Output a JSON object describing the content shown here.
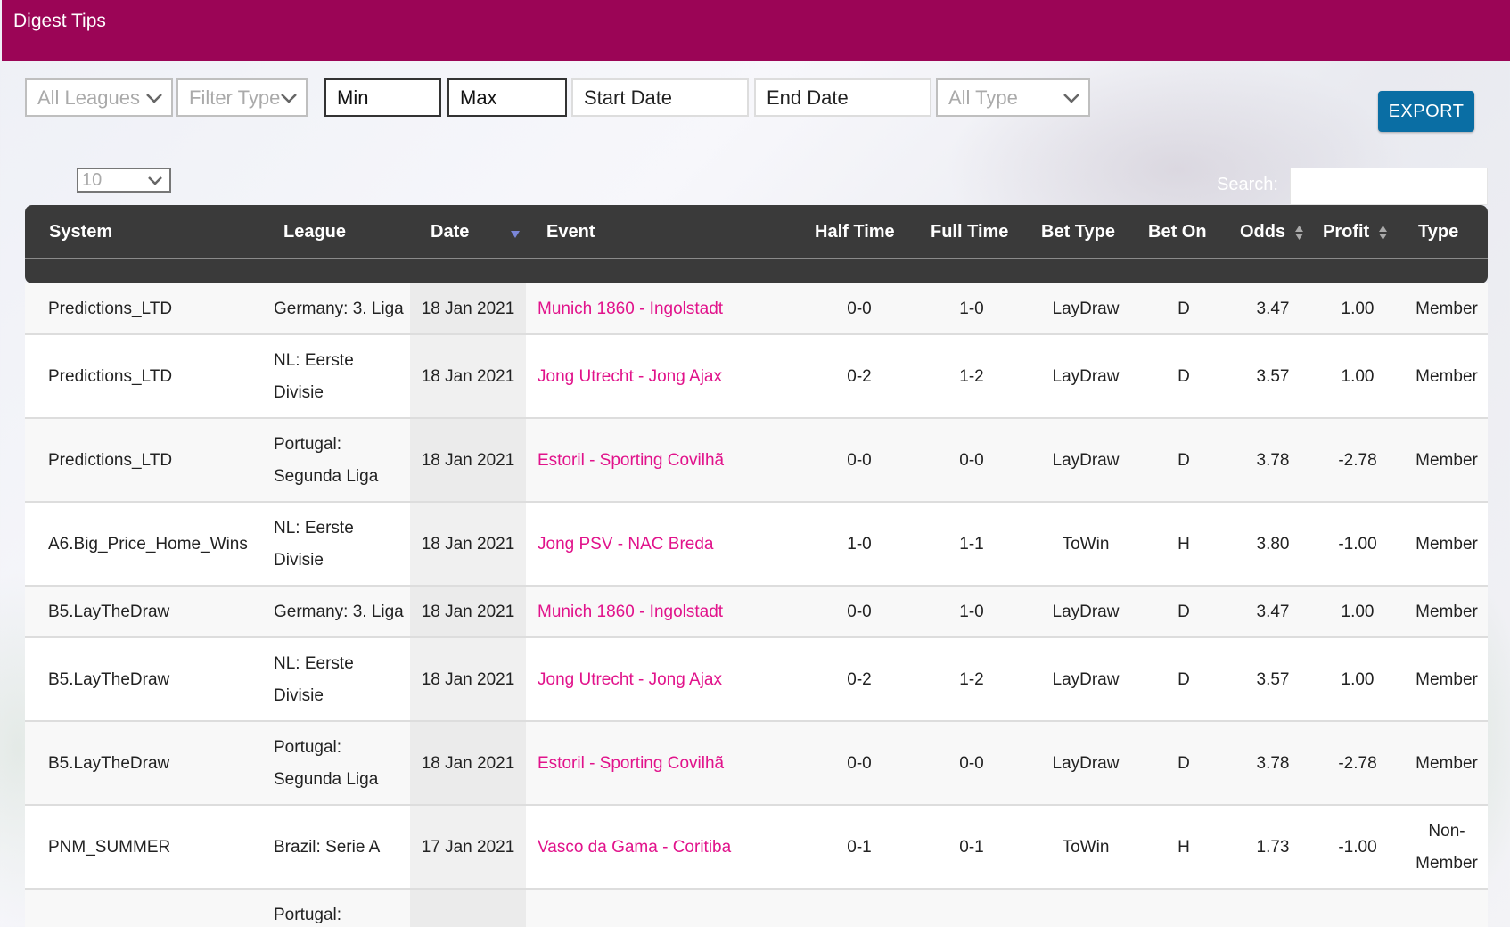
{
  "header": {
    "title": "Digest Tips"
  },
  "filters": {
    "leagues": "All Leagues",
    "filter_type": "Filter Type",
    "min": "Min",
    "max": "Max",
    "start_date": "Start Date",
    "end_date": "End Date",
    "all_type": "All Type"
  },
  "export_label": "EXPORT",
  "page_size": "10",
  "search_label": "Search:",
  "columns": [
    "System",
    "League",
    "Date",
    "Event",
    "Half Time",
    "Full Time",
    "Bet Type",
    "Bet On",
    "Odds",
    "Profit",
    "Type"
  ],
  "rows": [
    {
      "system": "Predictions_LTD",
      "league": [
        "Germany: 3. Liga"
      ],
      "date": "18 Jan 2021",
      "event": "Munich 1860 - Ingolstadt",
      "half_time": "0-0",
      "full_time": "1-0",
      "bet_type": "LayDraw",
      "bet_on": "D",
      "odds": "3.47",
      "profit": "1.00",
      "type": [
        "Member"
      ]
    },
    {
      "system": "Predictions_LTD",
      "league": [
        "NL: Eerste",
        "Divisie"
      ],
      "date": "18 Jan 2021",
      "event": "Jong Utrecht - Jong Ajax",
      "half_time": "0-2",
      "full_time": "1-2",
      "bet_type": "LayDraw",
      "bet_on": "D",
      "odds": "3.57",
      "profit": "1.00",
      "type": [
        "Member"
      ]
    },
    {
      "system": "Predictions_LTD",
      "league": [
        "Portugal:",
        "Segunda Liga"
      ],
      "date": "18 Jan 2021",
      "event": "Estoril - Sporting Covilhã",
      "half_time": "0-0",
      "full_time": "0-0",
      "bet_type": "LayDraw",
      "bet_on": "D",
      "odds": "3.78",
      "profit": "-2.78",
      "type": [
        "Member"
      ]
    },
    {
      "system": "A6.Big_Price_Home_Wins",
      "league": [
        "NL: Eerste",
        "Divisie"
      ],
      "date": "18 Jan 2021",
      "event": "Jong PSV - NAC Breda",
      "half_time": "1-0",
      "full_time": "1-1",
      "bet_type": "ToWin",
      "bet_on": "H",
      "odds": "3.80",
      "profit": "-1.00",
      "type": [
        "Member"
      ]
    },
    {
      "system": "B5.LayTheDraw",
      "league": [
        "Germany: 3. Liga"
      ],
      "date": "18 Jan 2021",
      "event": "Munich 1860 - Ingolstadt",
      "half_time": "0-0",
      "full_time": "1-0",
      "bet_type": "LayDraw",
      "bet_on": "D",
      "odds": "3.47",
      "profit": "1.00",
      "type": [
        "Member"
      ]
    },
    {
      "system": "B5.LayTheDraw",
      "league": [
        "NL: Eerste",
        "Divisie"
      ],
      "date": "18 Jan 2021",
      "event": "Jong Utrecht - Jong Ajax",
      "half_time": "0-2",
      "full_time": "1-2",
      "bet_type": "LayDraw",
      "bet_on": "D",
      "odds": "3.57",
      "profit": "1.00",
      "type": [
        "Member"
      ]
    },
    {
      "system": "B5.LayTheDraw",
      "league": [
        "Portugal:",
        "Segunda Liga"
      ],
      "date": "18 Jan 2021",
      "event": "Estoril - Sporting Covilhã",
      "half_time": "0-0",
      "full_time": "0-0",
      "bet_type": "LayDraw",
      "bet_on": "D",
      "odds": "3.78",
      "profit": "-2.78",
      "type": [
        "Member"
      ]
    },
    {
      "system": "PNM_SUMMER",
      "league": [
        "Brazil: Serie A"
      ],
      "date": "17 Jan 2021",
      "event": "Vasco da Gama - Coritiba",
      "half_time": "0-1",
      "full_time": "0-1",
      "bet_type": "ToWin",
      "bet_on": "H",
      "odds": "1.73",
      "profit": "-1.00",
      "type": [
        "Non-",
        "Member"
      ]
    },
    {
      "system": "",
      "league": [
        "Portugal:"
      ],
      "date": "",
      "event": "",
      "half_time": "",
      "full_time": "",
      "bet_type": "",
      "bet_on": "",
      "odds": "",
      "profit": "",
      "type": [
        ""
      ]
    }
  ],
  "colors": {
    "topbar": "#9b0556",
    "event_link": "#e1138b",
    "export": "#0a6ea4",
    "table_header": "#3a3a3a"
  },
  "icons": {
    "dropdown": "chevron-down-icon",
    "sort": "sort-icon",
    "sort_desc": "sort-desc-icon"
  }
}
